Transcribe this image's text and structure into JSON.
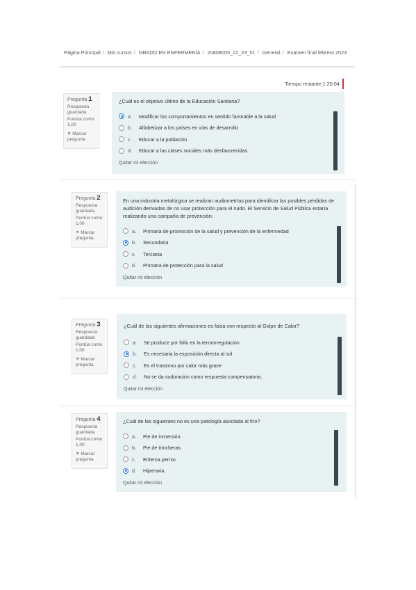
{
  "breadcrumb": [
    "Página Principal",
    "Mis cursos",
    "GRADO EN ENFERMERÍA",
    "20808005_22_23_01",
    "General",
    "Examen final febrero 2023"
  ],
  "timer": {
    "label": "Tiempo restante",
    "value": "1:20:04"
  },
  "question_label": "Pregunta",
  "status_text": "Respuesta guardada",
  "score_text": "Puntúa como 1,00",
  "flag_text": "Marcar pregunta",
  "clear_choice": "Quitar mi elección",
  "questions": [
    {
      "number": "1",
      "text": "¿Cuál es el objetivo último de la Educación Sanitaria?",
      "answers": [
        {
          "letter": "a.",
          "text": "Modificar los comportamientos en sentido favorable a la salud",
          "selected": true
        },
        {
          "letter": "b.",
          "text": "Alfabetizar a los países en vías de desarrollo",
          "selected": false
        },
        {
          "letter": "c.",
          "text": "Educar a la población",
          "selected": false
        },
        {
          "letter": "d.",
          "text": "Educar a las clases sociales más desfavorecidas",
          "selected": false
        }
      ]
    },
    {
      "number": "2",
      "text": "En una industria metalúrgica se realizan audiometrías para identificar las posibles pérdidas de audición derivadas de no usar protección para el ruido. El Servicio de Salud Pública estaría realizando una campaña de prevención:",
      "answers": [
        {
          "letter": "a.",
          "text": "Primaria de promoción de la salud y prevención de la enfermedad",
          "selected": false
        },
        {
          "letter": "b.",
          "text": "Secundaria",
          "selected": true
        },
        {
          "letter": "c.",
          "text": "Terciaria",
          "selected": false
        },
        {
          "letter": "d.",
          "text": "Primaria de protección para la salud",
          "selected": false
        }
      ]
    },
    {
      "number": "3",
      "text": "¿Cuál de las siguientes afirmaciones es falsa con respecto al Golpe de Calor?",
      "answers": [
        {
          "letter": "a.",
          "text": "Se produce por fallo en la termorregulación",
          "selected": false
        },
        {
          "letter": "b.",
          "text": "Es necesaria la exposición directa al sol",
          "selected": true
        },
        {
          "letter": "c.",
          "text": "Es el trastorno por calor más grave",
          "selected": false
        },
        {
          "letter": "d.",
          "text": "No se da sudoración como respuesta compensatoria.",
          "selected": false
        }
      ]
    },
    {
      "number": "4",
      "text": "¿Cuál de las siguientes no es una patología asociada al frío?",
      "answers": [
        {
          "letter": "a.",
          "text": "Pie de inmersión.",
          "selected": false
        },
        {
          "letter": "b.",
          "text": "Pie de trincheras.",
          "selected": false
        },
        {
          "letter": "c.",
          "text": "Eritema pernio.",
          "selected": false
        },
        {
          "letter": "d.",
          "text": "Hiperaxia.",
          "selected": true
        }
      ]
    }
  ]
}
